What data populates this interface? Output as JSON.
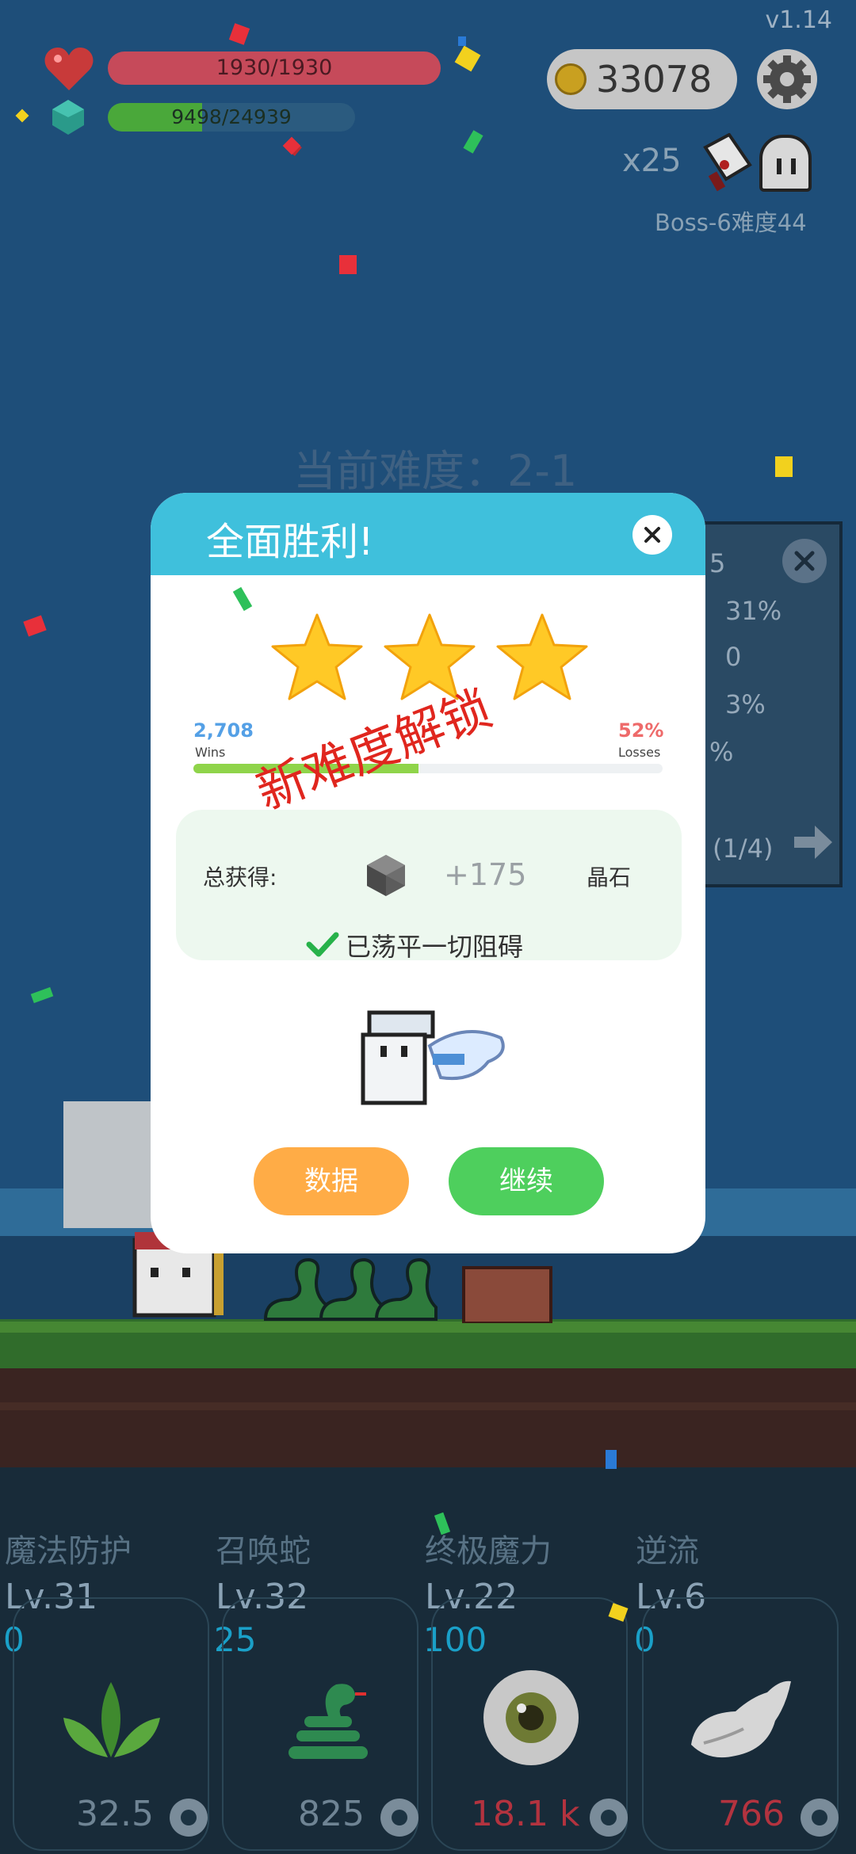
{
  "version": "v1.14",
  "player": {
    "hp_text": "1930/1930",
    "xp_text": "9498/24939",
    "xp_fraction": 0.3808
  },
  "coins": "33078",
  "boss": {
    "multiplier": "x25",
    "label": "Boss-6难度44"
  },
  "current_difficulty": "当前难度：2-1",
  "side_panel": {
    "rows": [
      "5",
      "31%",
      "0",
      "3%",
      "%"
    ],
    "page": "(1/4)"
  },
  "popup": {
    "title": "全面胜利!",
    "stars": 3,
    "wins_value": "2,708",
    "wins_label": "Wins",
    "losses_value": "52%",
    "losses_label": "Losses",
    "win_fraction": 0.48,
    "total_label": "总获得:",
    "reward_amount": "+175",
    "reward_name": "晶石",
    "cleared_text": "已荡平一切阻碍",
    "unlock_stamp": "新难度解锁",
    "btn_data": "数据",
    "btn_continue": "继续"
  },
  "skills": [
    {
      "name": "魔法防护",
      "level": "Lv.31",
      "cost": "0",
      "value": "32.5",
      "value_color": "#6f8494",
      "icon": "leaf-icon"
    },
    {
      "name": "召唤蛇",
      "level": "Lv.32",
      "cost": "25",
      "value": "825",
      "value_color": "#6f8494",
      "icon": "snake-icon"
    },
    {
      "name": "终极魔力",
      "level": "Lv.22",
      "cost": "100",
      "value": "18.1 k",
      "value_color": "#b3333f",
      "icon": "eye-icon"
    },
    {
      "name": "逆流",
      "level": "Lv.6",
      "cost": "0",
      "value": "766",
      "value_color": "#b3333f",
      "icon": "wing-icon"
    }
  ],
  "colors": {
    "popup_header": "#3fc0dc",
    "hp_bar": "#c64a5a",
    "xp_bar": "#4aa83a",
    "continue_button": "#4ecf5d",
    "data_button": "#ffac46",
    "stamp": "#e0261e"
  }
}
